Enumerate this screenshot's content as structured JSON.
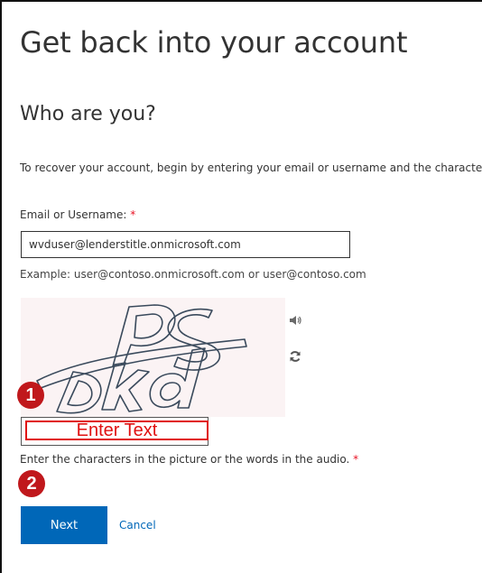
{
  "page": {
    "title": "Get back into your account",
    "subtitle": "Who are you?",
    "instructions": "To recover your account, begin by entering your email or username and the characters in the picture or audio below."
  },
  "email": {
    "label": "Email or Username:",
    "required_mark": "*",
    "value": "wvduser@lenderstitle.onmicrosoft.com",
    "example": "Example: user@contoso.onmicrosoft.com or user@contoso.com"
  },
  "captcha": {
    "placeholder": "Enter Text",
    "hint": "Enter the characters in the picture or the words in the audio.",
    "required_mark": "*",
    "audio_icon": "speaker-icon",
    "refresh_icon": "refresh-icon"
  },
  "annotations": {
    "step1": "1",
    "step2": "2",
    "color": "#c0181c"
  },
  "actions": {
    "next_label": "Next",
    "cancel_label": "Cancel"
  },
  "colors": {
    "primary": "#0067b8",
    "required": "#e81123",
    "highlight": "#e01010"
  }
}
